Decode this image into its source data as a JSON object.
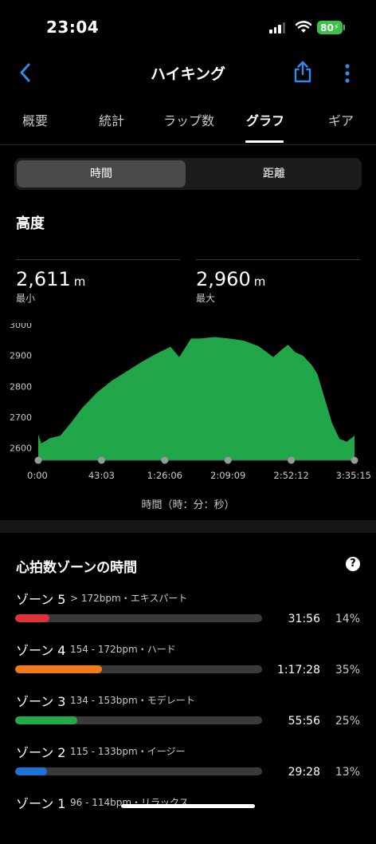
{
  "status": {
    "time": "23:04",
    "battery": "80"
  },
  "nav": {
    "title": "ハイキング"
  },
  "tabs": [
    "概要",
    "統計",
    "ラップ数",
    "グラフ",
    "ギア"
  ],
  "segment": {
    "time": "時間",
    "distance": "距離"
  },
  "elevation": {
    "title": "高度",
    "min_value": "2,611",
    "min_unit": "m",
    "min_label": "最小",
    "max_value": "2,960",
    "max_unit": "m",
    "max_label": "最大",
    "x_axis_title": "時間（時：分：秒）"
  },
  "chart_data": {
    "type": "area",
    "color": "#22a64a",
    "y_ticks": [
      3000,
      2900,
      2800,
      2700,
      2600
    ],
    "ylim": [
      2560,
      3000
    ],
    "x_ticks": [
      "0:00",
      "43:03",
      "1:26:06",
      "2:09:09",
      "2:52:12",
      "3:35:15"
    ],
    "x_minutes": [
      0,
      2,
      4,
      8,
      15,
      22,
      30,
      40,
      50,
      60,
      70,
      80,
      90,
      96,
      100,
      104,
      110,
      116,
      120,
      130,
      140,
      150,
      160,
      166,
      170,
      175,
      180,
      186,
      190,
      195,
      200,
      205,
      210,
      215.25
    ],
    "y_values": [
      2645,
      2615,
      2620,
      2632,
      2640,
      2680,
      2730,
      2780,
      2818,
      2848,
      2878,
      2905,
      2928,
      2895,
      2925,
      2955,
      2955,
      2958,
      2960,
      2955,
      2948,
      2930,
      2895,
      2920,
      2935,
      2910,
      2900,
      2870,
      2840,
      2760,
      2680,
      2630,
      2620,
      2640
    ]
  },
  "hr_zones": {
    "title": "心拍数ゾーンの時間",
    "help": "?",
    "zones": [
      {
        "name": "ゾーン 5",
        "range": "> 172bpm・エキスパート",
        "time": "31:56",
        "pct": "14%",
        "fraction": 0.14,
        "color": "#e0323a"
      },
      {
        "name": "ゾーン 4",
        "range": "154 - 172bpm・ハード",
        "time": "1:17:28",
        "pct": "35%",
        "fraction": 0.35,
        "color": "#f07a1c"
      },
      {
        "name": "ゾーン 3",
        "range": "134 - 153bpm・モデレート",
        "time": "55:56",
        "pct": "25%",
        "fraction": 0.25,
        "color": "#25a84a"
      },
      {
        "name": "ゾーン 2",
        "range": "115 - 133bpm・イージー",
        "time": "29:28",
        "pct": "13%",
        "fraction": 0.13,
        "color": "#1e72d6"
      },
      {
        "name": "ゾーン 1",
        "range": "96 - 114bpm・リラックス",
        "time": "",
        "pct": "",
        "fraction": 0,
        "color": "#9a9a9a"
      }
    ]
  }
}
